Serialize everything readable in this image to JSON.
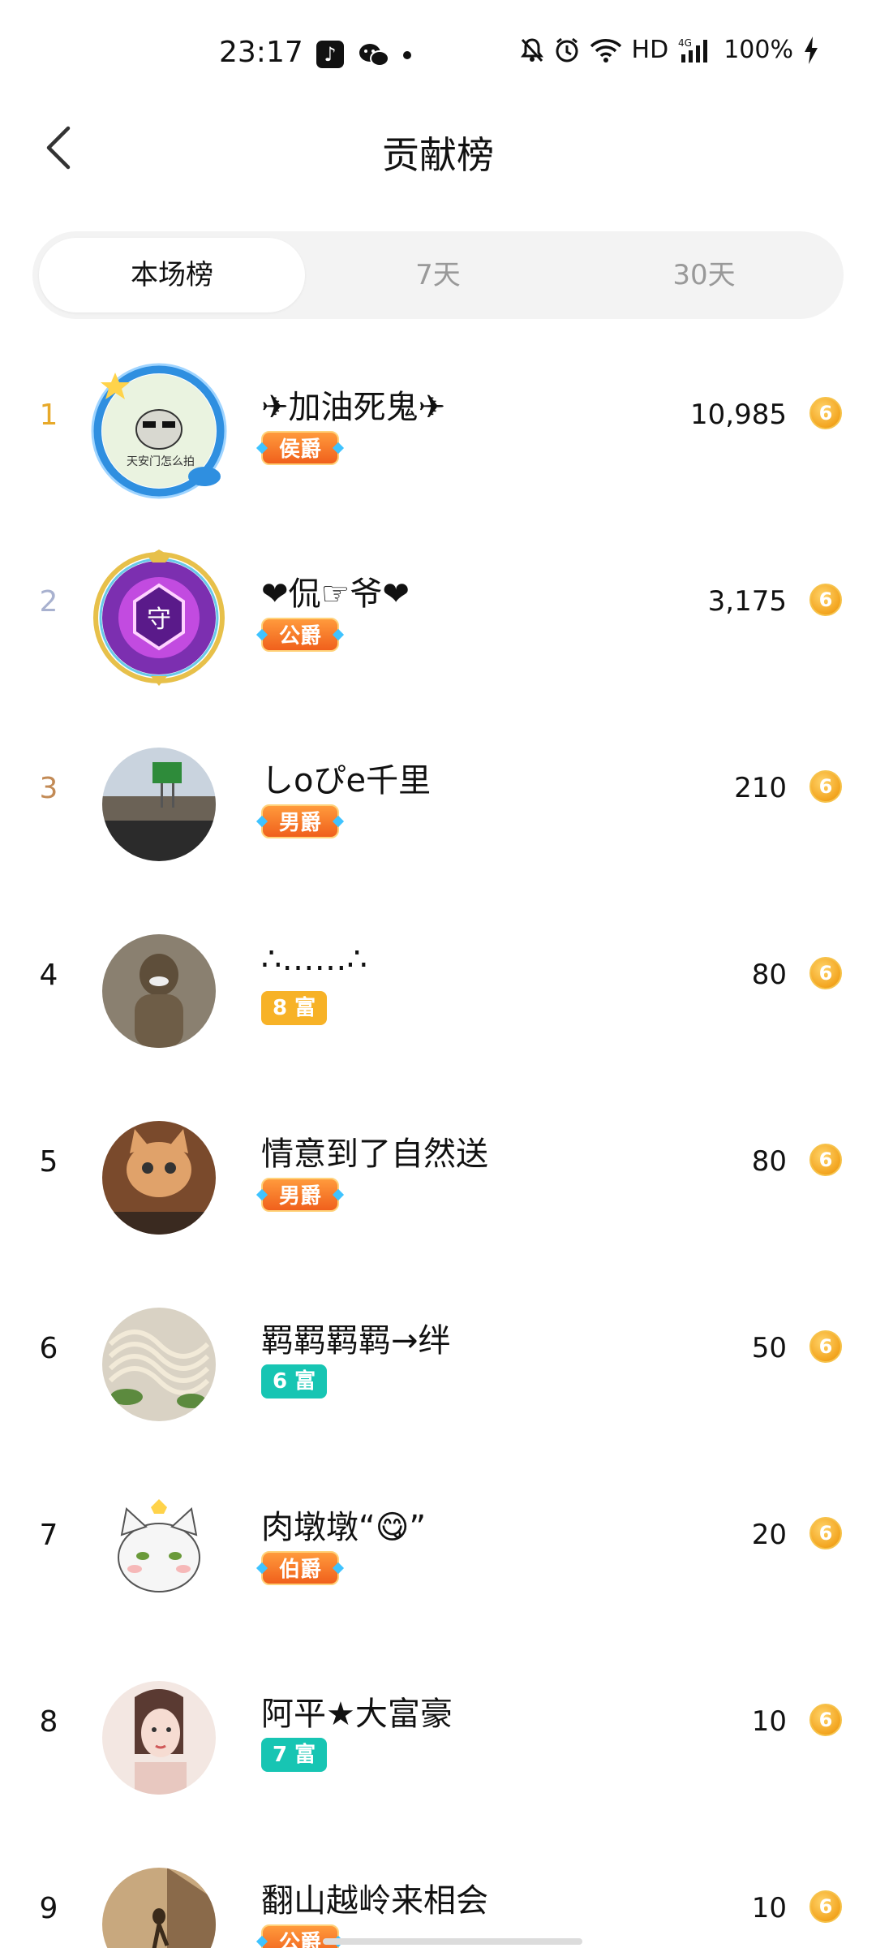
{
  "status_bar": {
    "time": "23:17",
    "network": "4G",
    "hd": "HD",
    "battery": "100%",
    "icons": [
      "tiktok-icon",
      "wechat-icon",
      "mute-icon",
      "alarm-icon",
      "wifi-icon",
      "signal-icon",
      "charging-icon"
    ]
  },
  "header": {
    "title": "贡献榜",
    "back_icon": "chevron-left-icon"
  },
  "tabs": [
    {
      "label": "本场榜",
      "active": true
    },
    {
      "label": "7天",
      "active": false
    },
    {
      "label": "30天",
      "active": false
    }
  ],
  "ranking": [
    {
      "rank": "1",
      "name": "✈加油死鬼✈",
      "badge": "侯爵",
      "badge_type": "noble",
      "score": "10,985"
    },
    {
      "rank": "2",
      "name": "❤侃☞爷❤",
      "badge": "公爵",
      "badge_type": "noble",
      "score": "3,175"
    },
    {
      "rank": "3",
      "name": "しoぴe千里",
      "badge": "男爵",
      "badge_type": "noble",
      "score": "210"
    },
    {
      "rank": "4",
      "name": "∴……∴",
      "badge": "8 富",
      "badge_type": "rich-orange",
      "score": "80"
    },
    {
      "rank": "5",
      "name": "情意到了自然送",
      "badge": "男爵",
      "badge_type": "noble",
      "score": "80"
    },
    {
      "rank": "6",
      "name": "羁羁羁羁→绊",
      "badge": "6 富",
      "badge_type": "rich-teal",
      "score": "50"
    },
    {
      "rank": "7",
      "name": "肉墩墩“😋”",
      "badge": "伯爵",
      "badge_type": "noble",
      "score": "20"
    },
    {
      "rank": "8",
      "name": "阿平★大富豪",
      "badge": "7 富",
      "badge_type": "rich-teal",
      "score": "10"
    },
    {
      "rank": "9",
      "name": "翻山越岭来相会",
      "badge": "公爵",
      "badge_type": "noble",
      "score": "10"
    }
  ],
  "coin_icon": "coin-icon",
  "coin_symbol": "6",
  "colors": {
    "rank_1": "#e7a92a",
    "rank_2": "#a8b1cf",
    "rank_3": "#c28a55",
    "noble_badge": "#f0601c",
    "rich_orange": "#f7b227",
    "rich_teal": "#17c5b3",
    "coin": "#f3a520"
  }
}
